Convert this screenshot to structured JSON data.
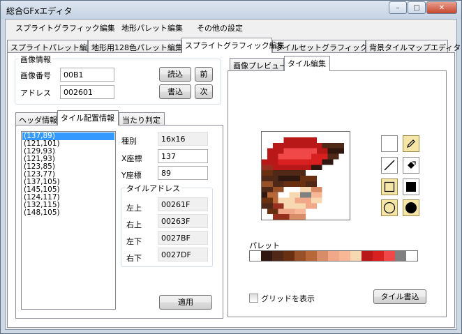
{
  "window": {
    "title": "総合GFxエディタ",
    "minimize": "–",
    "maximize": "□",
    "close": "✕"
  },
  "menu": [
    "スプライトグラフィック編集",
    "地形パレット編集",
    "その他の設定"
  ],
  "main_tabs": [
    "スプライトパレット編集",
    "地形用128色パレット編集",
    "スプライトグラフィック編集",
    "タイルセットグラフィック編集",
    "背景タイルマップエディタ"
  ],
  "image_info": {
    "group_label": "画像情報",
    "number_label": "画像番号",
    "number_value": "00B1",
    "address_label": "アドレス",
    "address_value": "002601",
    "load_button": "読込",
    "write_button": "書込",
    "prev_button": "前",
    "next_button": "次"
  },
  "sub_tabs": [
    "ヘッダ情報",
    "タイル配置情報",
    "当たり判定"
  ],
  "tile_list": [
    "(137,89)",
    "(121,101)",
    "(129,93)",
    "(121,93)",
    "(123,85)",
    "(123,77)",
    "(137,105)",
    "(145,105)",
    "(124,117)",
    "(132,115)",
    "(148,105)"
  ],
  "tile_props": {
    "type_label": "種別",
    "type_value": "16x16",
    "x_label": "X座標",
    "x_value": "137",
    "y_label": "Y座標",
    "y_value": "89",
    "address_group": "タイルアドレス",
    "tl_label": "左上",
    "tl_value": "00261F",
    "tr_label": "右上",
    "tr_value": "00263F",
    "bl_label": "左下",
    "bl_value": "0027BF",
    "br_label": "右下",
    "br_value": "0027DF",
    "apply_button": "適用"
  },
  "right_tabs": [
    "画像プレビュー",
    "タイル編集"
  ],
  "palette_label": "パレット",
  "palette_colors": [
    "#ffffff",
    "#301810",
    "#502818",
    "#683010",
    "#985028",
    "#b86838",
    "#d88c68",
    "#f0a888",
    "#f8b898",
    "#f8d8b0",
    "#b81818",
    "#d82020",
    "#f04848",
    "#808080",
    "#ffffff"
  ],
  "tools": [
    "blank-swatch",
    "pencil-icon",
    "line-icon",
    "fill-bucket-icon",
    "rect-outline-icon",
    "rect-filled-icon",
    "ellipse-outline-icon",
    "ellipse-filled-icon"
  ],
  "grid_checkbox": "グリッドを表示",
  "tile_write_button": "タイル書込"
}
